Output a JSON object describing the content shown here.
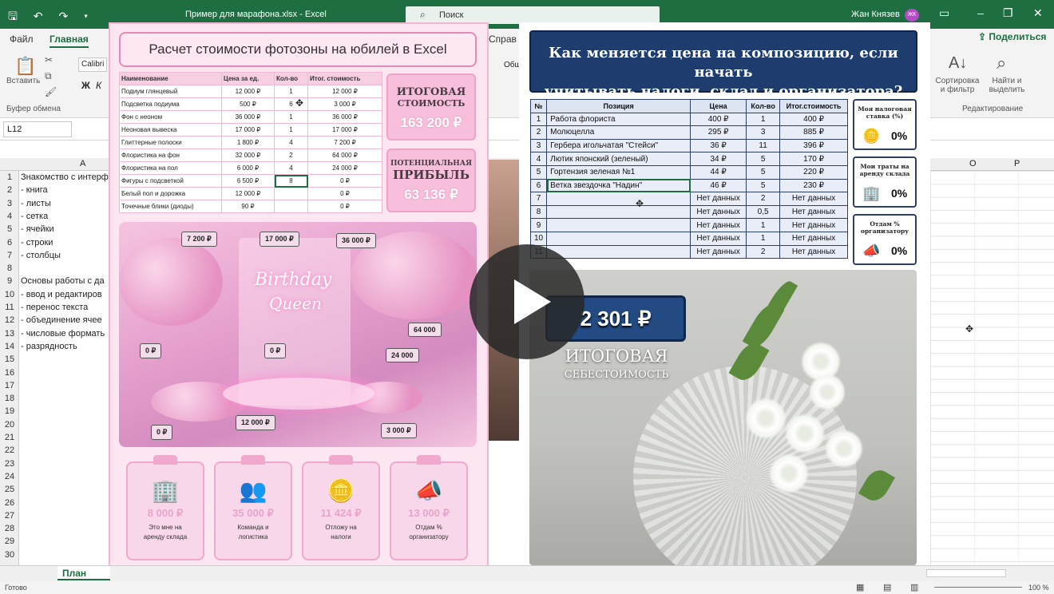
{
  "excel": {
    "file_title": "Пример для марафона.xlsx  -  Excel",
    "search_placeholder": "Поиск",
    "user_name": "Жан Князев",
    "user_initials": "ЖК",
    "tabs": [
      "Файл",
      "Главная",
      "Справ"
    ],
    "share_label": "Поделиться",
    "paste_label": "Вставить",
    "clipboard_label": "Буфер обмена",
    "font_name": "Calibri",
    "font_tool_preview": "Обш",
    "sort_label": "Сортировка и фильтр",
    "find_label": "Найти и выделить",
    "editing_label": "Редактирование",
    "name_box": "L12",
    "col_a": "A",
    "col_o": "O",
    "col_p": "P",
    "rows": [
      {
        "n": "1",
        "a": "Знакомство с интерф"
      },
      {
        "n": "2",
        "a": " - книга"
      },
      {
        "n": "3",
        "a": " - листы"
      },
      {
        "n": "4",
        "a": " - сетка"
      },
      {
        "n": "5",
        "a": " - ячейки"
      },
      {
        "n": "6",
        "a": " - строки"
      },
      {
        "n": "7",
        "a": " - столбцы"
      },
      {
        "n": "8",
        "a": ""
      },
      {
        "n": "9",
        "a": "Основы работы с да"
      },
      {
        "n": "10",
        "a": " - ввод и редактиров"
      },
      {
        "n": "11",
        "a": " - перенос текста"
      },
      {
        "n": "12",
        "a": " - объединение ячее"
      },
      {
        "n": "13",
        "a": " - числовые формать"
      },
      {
        "n": "14",
        "a": " - разрядность"
      },
      {
        "n": "15",
        "a": ""
      },
      {
        "n": "16",
        "a": ""
      },
      {
        "n": "17",
        "a": ""
      },
      {
        "n": "18",
        "a": ""
      },
      {
        "n": "19",
        "a": ""
      },
      {
        "n": "20",
        "a": ""
      },
      {
        "n": "21",
        "a": ""
      },
      {
        "n": "22",
        "a": ""
      },
      {
        "n": "23",
        "a": ""
      },
      {
        "n": "24",
        "a": ""
      },
      {
        "n": "25",
        "a": ""
      },
      {
        "n": "26",
        "a": ""
      },
      {
        "n": "27",
        "a": ""
      },
      {
        "n": "28",
        "a": ""
      },
      {
        "n": "29",
        "a": ""
      },
      {
        "n": "30",
        "a": ""
      }
    ],
    "sheet_tab": "План урок",
    "status_ready": "Готово",
    "zoom": "100 %"
  },
  "left": {
    "title": "Расчет стоимости фотозоны на юбилей в Excel",
    "table_headers": [
      "Наименование",
      "Цена за ед.",
      "Кол-во",
      "Итог. стоимость"
    ],
    "table_rows": [
      [
        "Подиум глянцевый",
        "12 000 ₽",
        "1",
        "12 000 ₽"
      ],
      [
        "Подсветка подиума",
        "500 ₽",
        "6",
        "3 000 ₽"
      ],
      [
        "Фон с неоном",
        "36 000 ₽",
        "1",
        "36 000 ₽"
      ],
      [
        "Неоновая вывеска",
        "17 000 ₽",
        "1",
        "17 000 ₽"
      ],
      [
        "Глиттерные полоски",
        "1 800 ₽",
        "4",
        "7 200 ₽"
      ],
      [
        "Флористика на фон",
        "32 000 ₽",
        "2",
        "64 000 ₽"
      ],
      [
        "Флористика на пол",
        "6 000 ₽",
        "4",
        "24 000 ₽"
      ],
      [
        "Фигуры с подсветкой",
        "6 500 ₽",
        "8",
        "0 ₽"
      ],
      [
        "Белый пол и дорожка",
        "12 000 ₽",
        "",
        "0 ₽"
      ],
      [
        "Точечные блики (диоды)",
        "90 ₽",
        "",
        "0 ₽"
      ]
    ],
    "total_label_1": "ИТОГОВАЯ",
    "total_label_2": "СТОИМОСТЬ",
    "total_value": "163 200 ₽",
    "profit_label_1": "ПОТЕНЦИАЛЬНАЯ",
    "profit_label_2": "ПРИБЫЛЬ",
    "profit_value": "63 136 ₽",
    "neon_text_1": "Birthday",
    "neon_text_2": "Queen",
    "photo_tags": [
      "7 200 ₽",
      "17 000 ₽",
      "36 000 ₽",
      "64 000",
      "0 ₽",
      "0 ₽",
      "24 000",
      "12 000 ₽",
      "0 ₽",
      "3 000 ₽"
    ],
    "cards": [
      {
        "icon": "building-icon",
        "value": "8 000 ₽",
        "desc_1": "Это мне на",
        "desc_2": "аренду склада"
      },
      {
        "icon": "team-icon",
        "value": "35 000 ₽",
        "desc_1": "Команда и",
        "desc_2": "логистика"
      },
      {
        "icon": "coins-icon",
        "value": "11 424 ₽",
        "desc_1": "Отложу на",
        "desc_2": "налоги"
      },
      {
        "icon": "megaphone-icon",
        "value": "13 000 ₽",
        "desc_1": "Отдам %",
        "desc_2": "организатору"
      }
    ]
  },
  "right": {
    "title_1": "Как меняется цена на композицию, если начать",
    "title_2": "учитывать налоги, склад и организатора?",
    "table_headers": [
      "№",
      "Позиция",
      "Цена",
      "Кол-во",
      "Итог.стоимость"
    ],
    "table_rows": [
      [
        "1",
        "Работа флориста",
        "400 ₽",
        "1",
        "400 ₽"
      ],
      [
        "2",
        "Молюцелла",
        "295 ₽",
        "3",
        "885 ₽"
      ],
      [
        "3",
        "Гербера игольчатая \"Стейси\"",
        "36 ₽",
        "11",
        "396 ₽"
      ],
      [
        "4",
        "Лютик японский (зеленый)",
        "34 ₽",
        "5",
        "170 ₽"
      ],
      [
        "5",
        "Гортензия зеленая №1",
        "44 ₽",
        "5",
        "220 ₽"
      ],
      [
        "6",
        "Ветка звездочка \"Надин\"",
        "46 ₽",
        "5",
        "230 ₽"
      ],
      [
        "7",
        "",
        "Нет данных",
        "2",
        "Нет данных"
      ],
      [
        "8",
        "",
        "Нет данных",
        "0,5",
        "Нет данных"
      ],
      [
        "9",
        "",
        "Нет данных",
        "1",
        "Нет данных"
      ],
      [
        "10",
        "",
        "Нет данных",
        "1",
        "Нет данных"
      ],
      [
        "11",
        "",
        "Нет данных",
        "2",
        "Нет данных"
      ]
    ],
    "side_boxes": [
      {
        "title_1": "Моя налоговая",
        "title_2": "ставка (%)",
        "icon": "coins-icon",
        "value": "0%"
      },
      {
        "title_1": "Мои траты на",
        "title_2": "аренду склада",
        "icon": "building-icon",
        "value": "0%"
      },
      {
        "title_1": "Отдам %",
        "title_2": "организатору",
        "icon": "megaphone-icon",
        "value": "0%"
      }
    ],
    "cost_value": "2 301 ₽",
    "cost_label": "ИТОГОВАЯ",
    "cost_sublabel": "СЕБЕСТОИМОСТЬ"
  }
}
